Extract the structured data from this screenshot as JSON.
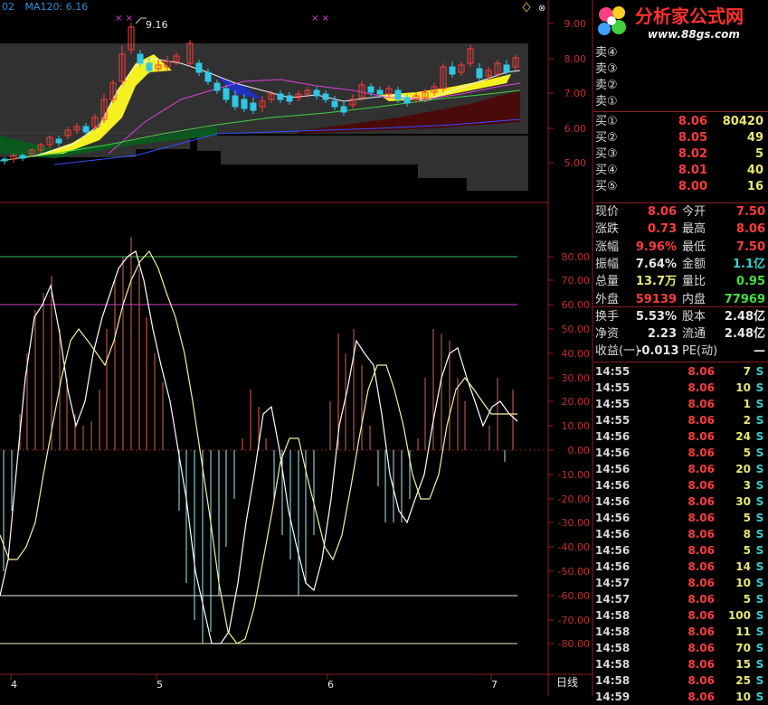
{
  "colors": {
    "up": "#ff3b3b",
    "down": "#2ec7e6",
    "grid_red": "#8b1e1e",
    "ma_white": "#f0f0f0",
    "ma_yellow": "#f5f560",
    "ma_magenta": "#e040e0",
    "ma_green": "#40d040",
    "ma_blue": "#3050ff",
    "osc_white": "#ffffff",
    "osc_yellow": "#f5f0a0"
  },
  "indicator_label": {
    "prefix": "02",
    "name": "MA120:",
    "value": "6.16"
  },
  "main_chart": {
    "type": "candlestick",
    "y_ticks": [
      "9.00",
      "8.00",
      "7.00",
      "6.00",
      "5.00"
    ],
    "high_annotation": "9.16",
    "markers": [
      "× ×",
      "× ×"
    ],
    "date_labels": [
      "4",
      "5",
      "6",
      "7"
    ],
    "ma120_value": 6.16
  },
  "oscillator": {
    "y_ticks": [
      "80.00",
      "70.00",
      "60.00",
      "50.00",
      "40.00",
      "30.00",
      "20.00",
      "10.00",
      "0.00",
      "-10.00",
      "-20.00",
      "-30.00",
      "-40.00",
      "-50.00",
      "-60.00",
      "-70.00",
      "-80.00"
    ],
    "reference_lines": [
      80,
      60,
      -60,
      -80
    ]
  },
  "period_label": "日线",
  "logo": {
    "text": "分析家公式网",
    "url": "www.88gs.com"
  },
  "order_book": {
    "sells": [
      {
        "label": "卖④",
        "price": "",
        "vol": ""
      },
      {
        "label": "卖③",
        "price": "",
        "vol": ""
      },
      {
        "label": "卖②",
        "price": "",
        "vol": ""
      },
      {
        "label": "卖①",
        "price": "",
        "vol": ""
      }
    ],
    "buys": [
      {
        "label": "买①",
        "price": "8.06",
        "vol": "80420"
      },
      {
        "label": "买②",
        "price": "8.05",
        "vol": "49"
      },
      {
        "label": "买③",
        "price": "8.02",
        "vol": "5"
      },
      {
        "label": "买④",
        "price": "8.01",
        "vol": "40"
      },
      {
        "label": "买⑤",
        "price": "8.00",
        "vol": "16"
      }
    ]
  },
  "quote": {
    "rows": [
      {
        "l1": "现价",
        "v1": "8.06",
        "c1": "#ff3b3b",
        "l2": "今开",
        "v2": "7.50",
        "c2": "#ff3b3b"
      },
      {
        "l1": "涨跌",
        "v1": "0.73",
        "c1": "#ff3b3b",
        "l2": "最高",
        "v2": "8.06",
        "c2": "#ff3b3b"
      },
      {
        "l1": "涨幅",
        "v1": "9.96%",
        "c1": "#ff3b3b",
        "l2": "最低",
        "v2": "7.50",
        "c2": "#ff3b3b"
      },
      {
        "l1": "振幅",
        "v1": "7.64%",
        "c1": "#e8e8e8",
        "l2": "金额",
        "v2": "1.1亿",
        "c2": "#35d0d0"
      },
      {
        "l1": "总量",
        "v1": "13.7万",
        "c1": "#e8e870",
        "l2": "量比",
        "v2": "0.95",
        "c2": "#40e040"
      },
      {
        "l1": "外盘",
        "v1": "59139",
        "c1": "#ff3b3b",
        "l2": "内盘",
        "v2": "77969",
        "c2": "#40e040"
      },
      {
        "l1": "换手",
        "v1": "5.53%",
        "c1": "#e8e8e8",
        "l2": "股本",
        "v2": "2.48亿",
        "c2": "#e8e8e8"
      },
      {
        "l1": "净资",
        "v1": "2.23",
        "c1": "#e8e8e8",
        "l2": "流通",
        "v2": "2.48亿",
        "c2": "#e8e8e8"
      },
      {
        "l1": "收益(一)",
        "v1": "-0.013",
        "c1": "#e8e8e8",
        "l2": "PE(动)",
        "v2": "—",
        "c2": "#e8e8e8"
      }
    ]
  },
  "ticks": [
    {
      "time": "14:55",
      "price": "8.06",
      "vol": "7",
      "side": "S"
    },
    {
      "time": "14:55",
      "price": "8.06",
      "vol": "10",
      "side": "S"
    },
    {
      "time": "14:55",
      "price": "8.06",
      "vol": "1",
      "side": "S"
    },
    {
      "time": "14:55",
      "price": "8.06",
      "vol": "2",
      "side": "S"
    },
    {
      "time": "14:56",
      "price": "8.06",
      "vol": "24",
      "side": "S"
    },
    {
      "time": "14:56",
      "price": "8.06",
      "vol": "5",
      "side": "S"
    },
    {
      "time": "14:56",
      "price": "8.06",
      "vol": "20",
      "side": "S"
    },
    {
      "time": "14:56",
      "price": "8.06",
      "vol": "3",
      "side": "S"
    },
    {
      "time": "14:56",
      "price": "8.06",
      "vol": "30",
      "side": "S"
    },
    {
      "time": "14:56",
      "price": "8.06",
      "vol": "5",
      "side": "S"
    },
    {
      "time": "14:56",
      "price": "8.06",
      "vol": "8",
      "side": "S"
    },
    {
      "time": "14:56",
      "price": "8.06",
      "vol": "5",
      "side": "S"
    },
    {
      "time": "14:56",
      "price": "8.06",
      "vol": "14",
      "side": "S"
    },
    {
      "time": "14:57",
      "price": "8.06",
      "vol": "10",
      "side": "S"
    },
    {
      "time": "14:57",
      "price": "8.06",
      "vol": "5",
      "side": "S"
    },
    {
      "time": "14:58",
      "price": "8.06",
      "vol": "100",
      "side": "S"
    },
    {
      "time": "14:58",
      "price": "8.06",
      "vol": "11",
      "side": "S"
    },
    {
      "time": "14:58",
      "price": "8.06",
      "vol": "70",
      "side": "S"
    },
    {
      "time": "14:58",
      "price": "8.06",
      "vol": "15",
      "side": "S"
    },
    {
      "time": "14:58",
      "price": "8.06",
      "vol": "25",
      "side": "S"
    },
    {
      "time": "14:59",
      "price": "8.06",
      "vol": "10",
      "side": "S"
    }
  ],
  "osc_series": {
    "hist": [
      -50,
      -25,
      15,
      40,
      58,
      65,
      72,
      50,
      30,
      15,
      10,
      12,
      25,
      50,
      70,
      80,
      88,
      75,
      55,
      40,
      28,
      0,
      -25,
      -55,
      -70,
      -80,
      -75,
      -60,
      -40,
      -20,
      5,
      25,
      18,
      5,
      -20,
      -35,
      -45,
      -60,
      -55,
      -35,
      0,
      20,
      48,
      40,
      50,
      35,
      10,
      -15,
      -30,
      -30,
      -30,
      -20,
      5,
      30,
      50,
      48,
      45,
      30,
      20,
      0,
      0,
      10,
      30,
      -5,
      25
    ],
    "k": [
      -60,
      -45,
      -5,
      30,
      55,
      60,
      68,
      48,
      25,
      10,
      20,
      40,
      55,
      65,
      75,
      80,
      82,
      70,
      50,
      35,
      20,
      0,
      -20,
      -50,
      -65,
      -80,
      -80,
      -75,
      -55,
      -30,
      -10,
      15,
      18,
      0,
      -25,
      -40,
      -55,
      -58,
      -45,
      -20,
      10,
      25,
      45,
      40,
      35,
      15,
      -10,
      -25,
      -30,
      -20,
      -10,
      10,
      30,
      40,
      42,
      30,
      20,
      10,
      18,
      20,
      15,
      12
    ],
    "d": [
      -35,
      -45,
      -45,
      -40,
      -30,
      -10,
      10,
      30,
      45,
      50,
      45,
      40,
      35,
      45,
      60,
      70,
      78,
      82,
      75,
      65,
      55,
      40,
      20,
      -5,
      -30,
      -55,
      -75,
      -80,
      -78,
      -65,
      -45,
      -25,
      -5,
      5,
      5,
      -10,
      -25,
      -40,
      -45,
      -35,
      -15,
      5,
      25,
      35,
      35,
      25,
      10,
      -10,
      -20,
      -20,
      -10,
      10,
      25,
      30,
      25,
      20,
      15,
      15,
      15,
      15
    ]
  }
}
